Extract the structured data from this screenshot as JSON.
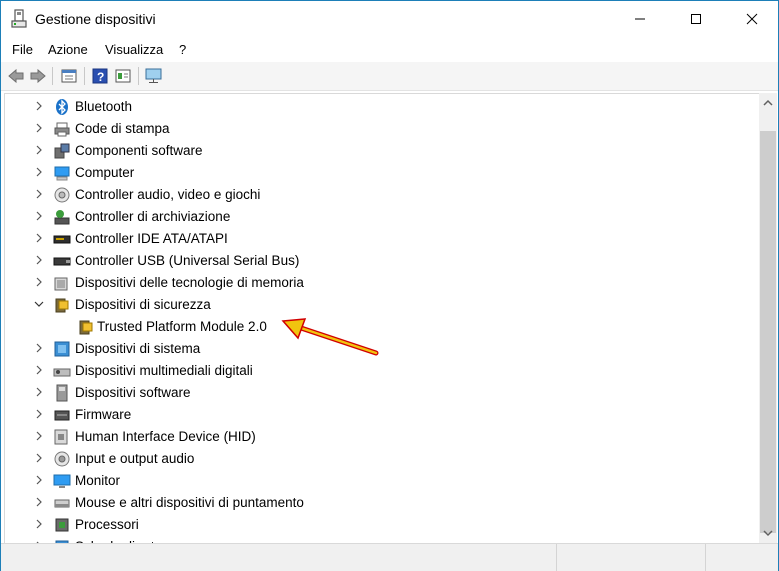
{
  "window": {
    "title": "Gestione dispositivi",
    "min_label": "—",
    "max_label": "☐",
    "close_label": "✕"
  },
  "menu": {
    "items": [
      "File",
      "Azione",
      "Visualizza",
      "?"
    ]
  },
  "toolbar": {
    "icons": [
      "back-arrow-icon",
      "forward-arrow-icon",
      "properties-icon",
      "help-icon",
      "update-driver-icon",
      "monitor-icon"
    ]
  },
  "tree": {
    "items": [
      {
        "label": "Bluetooth",
        "icon": "bluetooth-icon",
        "expanded": false
      },
      {
        "label": "Code di stampa",
        "icon": "printer-icon",
        "expanded": false
      },
      {
        "label": "Componenti software",
        "icon": "software-component-icon",
        "expanded": false
      },
      {
        "label": "Computer",
        "icon": "computer-icon",
        "expanded": false
      },
      {
        "label": "Controller audio, video e giochi",
        "icon": "speaker-icon",
        "expanded": false
      },
      {
        "label": "Controller di archiviazione",
        "icon": "storage-controller-icon",
        "expanded": false
      },
      {
        "label": "Controller IDE ATA/ATAPI",
        "icon": "ide-controller-icon",
        "expanded": false
      },
      {
        "label": "Controller USB (Universal Serial Bus)",
        "icon": "usb-icon",
        "expanded": false
      },
      {
        "label": "Dispositivi delle tecnologie di memoria",
        "icon": "memory-icon",
        "expanded": false
      },
      {
        "label": "Dispositivi di sicurezza",
        "icon": "security-device-icon",
        "expanded": true
      },
      {
        "label": "Trusted Platform Module 2.0",
        "icon": "tpm-icon",
        "child": true
      },
      {
        "label": "Dispositivi di sistema",
        "icon": "system-device-icon",
        "expanded": false
      },
      {
        "label": "Dispositivi multimediali digitali",
        "icon": "multimedia-icon",
        "expanded": false
      },
      {
        "label": "Dispositivi software",
        "icon": "software-device-icon",
        "expanded": false
      },
      {
        "label": "Firmware",
        "icon": "firmware-icon",
        "expanded": false
      },
      {
        "label": "Human Interface Device (HID)",
        "icon": "hid-icon",
        "expanded": false
      },
      {
        "label": "Input e output audio",
        "icon": "audio-io-icon",
        "expanded": false
      },
      {
        "label": "Monitor",
        "icon": "monitor-icon",
        "expanded": false
      },
      {
        "label": "Mouse e altri dispositivi di puntamento",
        "icon": "mouse-icon",
        "expanded": false
      },
      {
        "label": "Processori",
        "icon": "processor-icon",
        "expanded": false
      },
      {
        "label": "Schede di rete",
        "icon": "network-icon",
        "expanded": false
      }
    ]
  },
  "colors": {
    "accent": "#0078d7",
    "arrow": "#e8b800",
    "arrow_outline": "#d10000"
  }
}
